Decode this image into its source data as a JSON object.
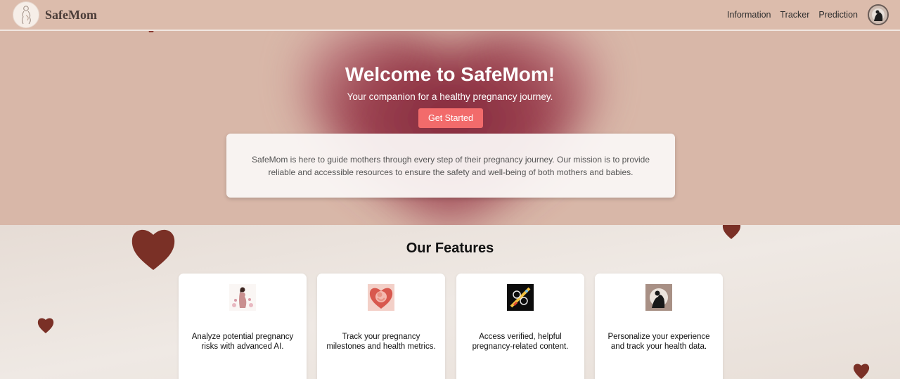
{
  "nav": {
    "brand": "SafeMom",
    "links": [
      "Information",
      "Tracker",
      "Prediction"
    ]
  },
  "hero": {
    "title": "Welcome to SafeMom!",
    "subtitle": "Your companion for a healthy pregnancy journey.",
    "cta": "Get Started",
    "mission": "SafeMom is here to guide mothers through every step of their pregnancy journey. Our mission is to provide reliable and accessible resources to ensure the safety and well-being of both mothers and babies."
  },
  "features": {
    "title": "Our Features",
    "cards": [
      {
        "icon": "pregnant-woman-icon",
        "text": "Analyze potential pregnancy risks with advanced AI."
      },
      {
        "icon": "heart-baby-icon",
        "text": "Track your pregnancy milestones and health metrics."
      },
      {
        "icon": "medical-content-icon",
        "text": "Access verified, helpful pregnancy-related content."
      },
      {
        "icon": "mother-child-icon",
        "text": "Personalize your experience and track your health data."
      }
    ]
  },
  "colors": {
    "navbar": "#dcbcac",
    "hero_bg": "#d8b7a8",
    "hero_heart": "#8a2f40",
    "cta": "#f26b6b",
    "page_bg": "#ece5e0",
    "heart_decor": "#7a3026"
  }
}
